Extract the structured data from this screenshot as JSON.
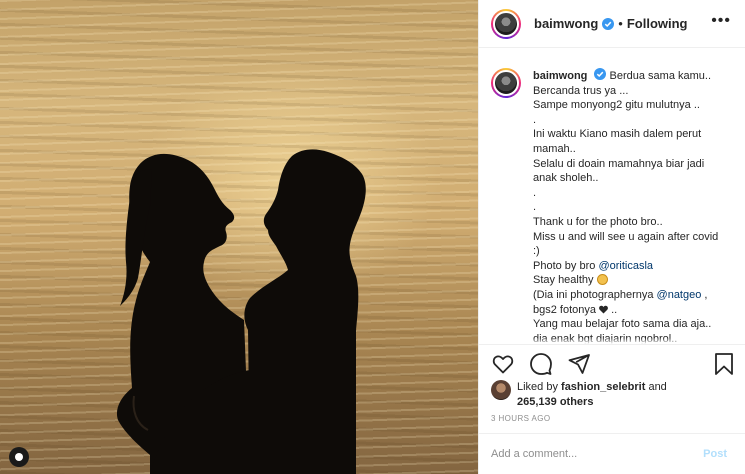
{
  "header": {
    "username": "baimwong",
    "separator": "•",
    "following_label": "Following",
    "more_label": "•••",
    "icons": {
      "verified": "verified-badge-icon",
      "more": "more-options-icon"
    },
    "colors": {
      "verified": "#3897f0"
    }
  },
  "caption": {
    "username": "baimwong",
    "first_line": "Berdua sama kamu..",
    "lines": [
      "Bercanda trus ya ...",
      "Sampe monyong2 gitu mulutnya ..",
      ".",
      "Ini waktu Kiano masih dalem perut",
      "mamah..",
      "Selalu di doain mamahnya biar jadi",
      "anak sholeh..",
      ".",
      ".",
      "Thank u for the photo bro..",
      "Miss u and will see u again after covid",
      ":)"
    ],
    "photo_by_prefix": "Photo by bro ",
    "photo_by_mention": "@oriticasla",
    "stay_healthy": "Stay healthy ",
    "dia_prefix": "(Dia ini photographernya ",
    "dia_mention": "@natgeo",
    "dia_suffix": " ,",
    "bgs2": "bgs2 fotonya ",
    "bgs2_suffix": " ..",
    "last_lines": [
      "Yang mau belajar foto sama dia aja..",
      "dia enak bgt diajarin ngobrol.."
    ]
  },
  "actions": {
    "icons": [
      "heart-icon",
      "comment-icon",
      "share-icon",
      "bookmark-icon"
    ]
  },
  "likes": {
    "prefix": "Liked by ",
    "liker": "fashion_selebrit",
    "and": " and",
    "count": "265,139 others"
  },
  "timestamp": "3 HOURS AGO",
  "comment": {
    "placeholder": "Add a comment...",
    "post_label": "Post",
    "colors": {
      "post_disabled": "#b2dffc"
    }
  },
  "media": {
    "description_icons": [
      "tag-icon"
    ]
  }
}
